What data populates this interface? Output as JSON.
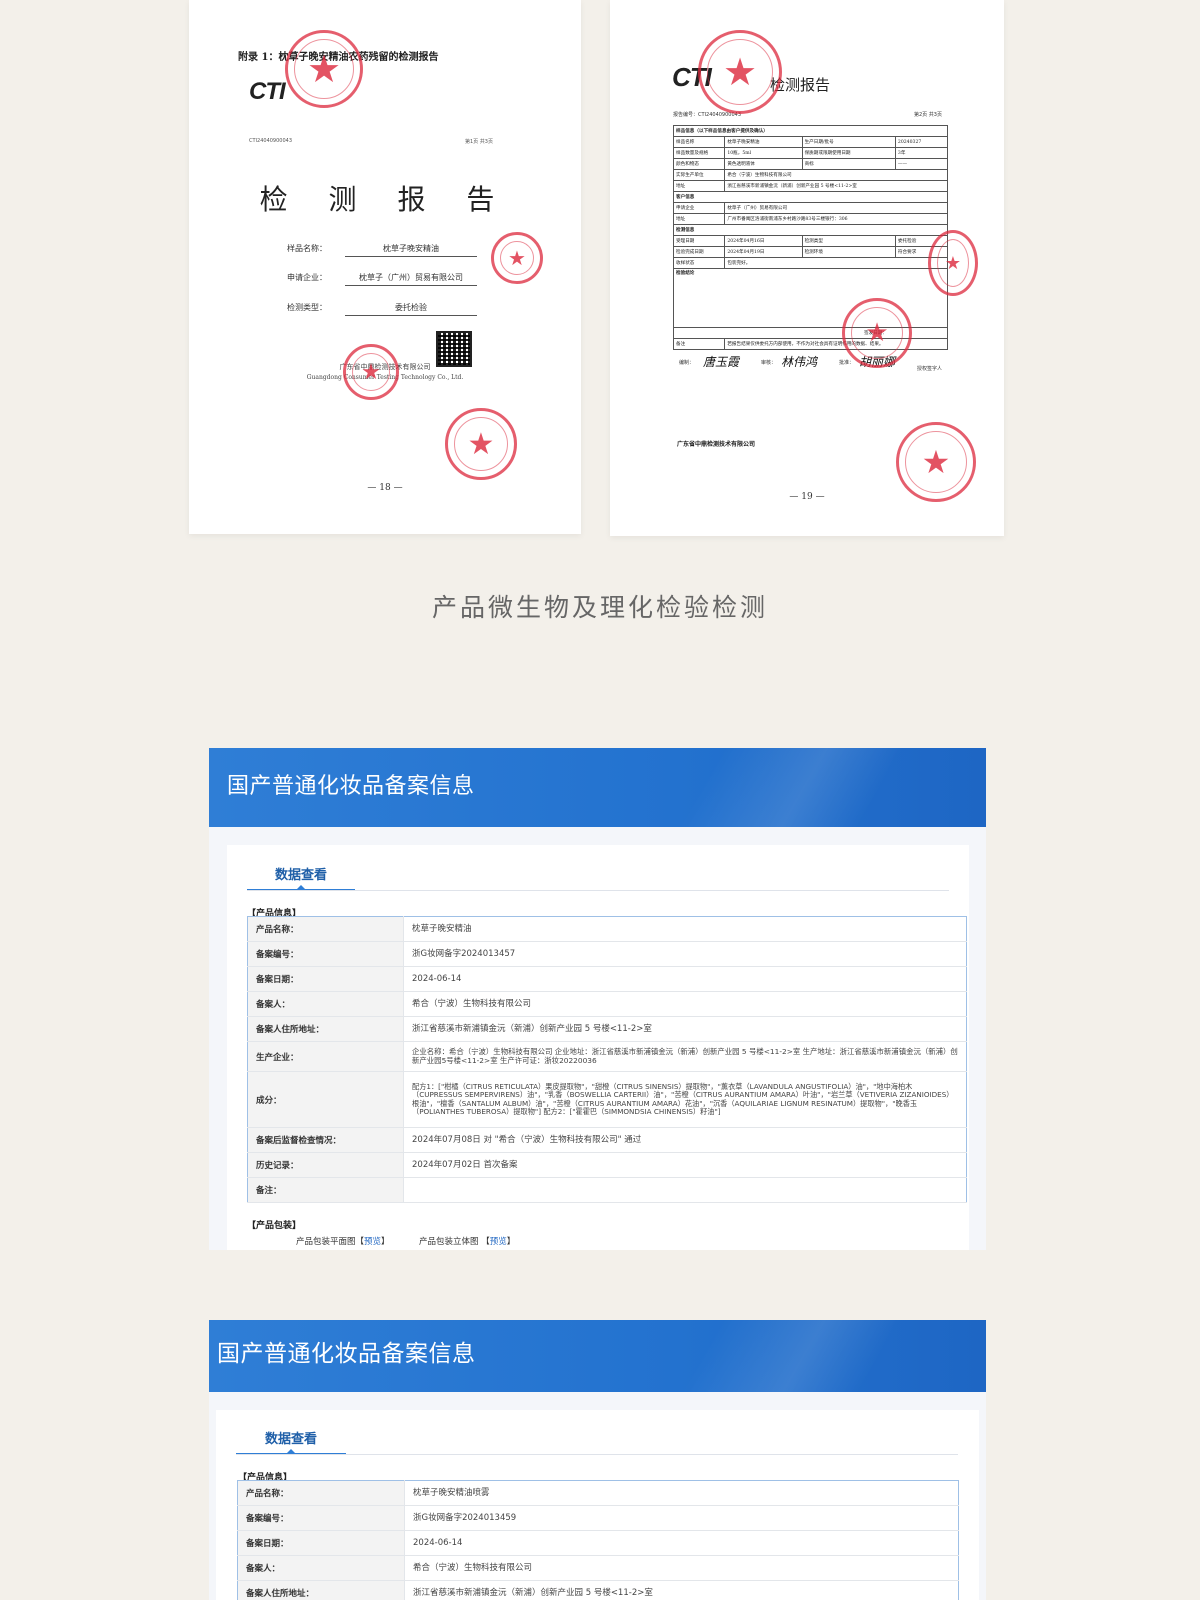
{
  "left_page": {
    "appendix_title": "附录 1：枕草子晚安精油农药残留的检测报告",
    "logo": "CTI",
    "report_no": "CTI24040900043",
    "page_info": "第1页  共3页",
    "title": "检 测 报 告",
    "rows": [
      {
        "label": "样品名称：",
        "value": "枕草子晚安精油"
      },
      {
        "label": "申请企业：",
        "value": "枕草子（广州）贸易有限公司"
      },
      {
        "label": "检测类型：",
        "value": "委托检验"
      }
    ],
    "org_cn": "广东省中鼎检测技术有限公司",
    "org_en": "Guangdong Consumer Testing Technology Co., Ltd.",
    "page_number": "— 18 —"
  },
  "right_page": {
    "logo": "CTI",
    "title": "检测报告",
    "report_no": "报告编号：CTI24040900043",
    "page_info": "第2页  共3页",
    "sample_section": "样品信息（以下样品信息由客户提供及确认）",
    "sample_rows": [
      [
        "样品名称",
        "枕草子晚安精油",
        "生产日期/批号",
        "20240327"
      ],
      [
        "样品数量及规格",
        "10瓶，5ml",
        "保质期或限期使用日期",
        "3年"
      ],
      [
        "颜色和物态",
        "黄色透明液体",
        "商标",
        "——"
      ],
      [
        "实际生产单位",
        "希合（宁波）生物科技有限公司",
        "",
        ""
      ],
      [
        "地址",
        "浙江省慈溪市新浦镇金沅（新浦）创新产业园 5 号楼<11-2>室",
        "",
        ""
      ]
    ],
    "client_section": "客户信息",
    "client_rows": [
      [
        "申请企业",
        "枕草子（广州）贸易有限公司"
      ],
      [
        "地址",
        "广州市番禺区洛浦街南浦东乡村路沙路83号三楼银行：306"
      ]
    ],
    "test_section": "检测信息",
    "test_rows": [
      [
        "受理日期",
        "2024年04月16日",
        "检测类型",
        "委托检验"
      ],
      [
        "检验完成日期",
        "2024年04月19日",
        "检测环境",
        "符合要求"
      ],
      [
        "收样状态",
        "包装完好。",
        "",
        ""
      ]
    ],
    "conclusion_section": "检验结论",
    "issue_date": "签发日期：",
    "remarks_label": "备注",
    "remarks": "若报告结果仅供委托方内部使用，不作为对社会具有证明作用的数据、结果。",
    "sign_labels": [
      "编制：",
      "审核：",
      "批准："
    ],
    "signatures": [
      "唐玉霞",
      "林伟鸿",
      "胡丽娜"
    ],
    "sign_tail": "授权签字人",
    "footer_org": "广东省中鼎检测技术有限公司",
    "page_number": "— 19 —"
  },
  "caption": "产品微生物及理化检验检测",
  "record1": {
    "header_title": "国产普通化妆品备案信息",
    "tab_label": "数据查看",
    "section_product": "【产品信息】",
    "rows": [
      {
        "k": "产品名称：",
        "v": "枕草子晚安精油"
      },
      {
        "k": "备案编号：",
        "v": "浙G妆网备字2024013457"
      },
      {
        "k": "备案日期：",
        "v": "2024-06-14"
      },
      {
        "k": "备案人：",
        "v": "希合（宁波）生物科技有限公司"
      },
      {
        "k": "备案人住所地址：",
        "v": "浙江省慈溪市新浦镇金沅（新浦）创新产业园 5 号楼<11-2>室"
      },
      {
        "k": "生产企业：",
        "v": "企业名称：希合（宁波）生物科技有限公司 企业地址：浙江省慈溪市新浦镇金沅（新浦）创新产业园 5 号楼<11-2>室 生产地址：浙江省慈溪市新浦镇金沅（新浦）创新产业园5号楼<11-2>室 生产许可证：浙妆20220036"
      },
      {
        "k": "成分：",
        "v": "配方1：[\"柑橘（CITRUS RETICULATA）果皮提取物\"，\"甜橙（CITRUS SINENSIS）提取物\"，\"薰衣草（LAVANDULA ANGUSTIFOLIA）油\"，\"地中海柏木（CUPRESSUS SEMPERVIRENS）油\"，\"乳香（BOSWELLIA CARTERII）油\"，\"苦橙（CITRUS AURANTIUM AMARA）叶油\"，\"岩兰草（VETIVERIA ZIZANIOIDES）根油\"，\"檀香（SANTALUM ALBUM）油\"，\"苦橙（CITRUS AURANTIUM AMARA）花油\"，\"沉香（AQUILARIAE LIGNUM RESINATUM）提取物\"，\"晚香玉（POLIANTHES TUBEROSA）提取物\"] 配方2：[\"霍霍巴（SIMMONDSIA CHINENSIS）籽油\"]"
      },
      {
        "k": "备案后监督检查情况：",
        "v": "2024年07月08日 对 \"希合（宁波）生物科技有限公司\" 通过"
      },
      {
        "k": "历史记录：",
        "v": "2024年07月02日 首次备案"
      },
      {
        "k": "备注：",
        "v": ""
      }
    ],
    "section_package": "【产品包装】",
    "pkg_flat_label": "产品包装平面图",
    "pkg_3d_label": "产品包装立体图",
    "preview_label": "预览"
  },
  "record2": {
    "header_title": "国产普通化妆品备案信息",
    "tab_label": "数据查看",
    "section_product": "【产品信息】",
    "rows": [
      {
        "k": "产品名称：",
        "v": "枕草子晚安精油喷雾"
      },
      {
        "k": "备案编号：",
        "v": "浙G妆网备字2024013459"
      },
      {
        "k": "备案日期：",
        "v": "2024-06-14"
      },
      {
        "k": "备案人：",
        "v": "希合（宁波）生物科技有限公司"
      },
      {
        "k": "备案人住所地址：",
        "v": "浙江省慈溪市新浦镇金沅（新浦）创新产业园 5 号楼<11-2>室"
      }
    ]
  },
  "colors": {
    "background": "#f3f0ea",
    "header_blue": "#2372cf",
    "link_blue": "#1f66c2",
    "stamp_red": "#dc283c"
  }
}
